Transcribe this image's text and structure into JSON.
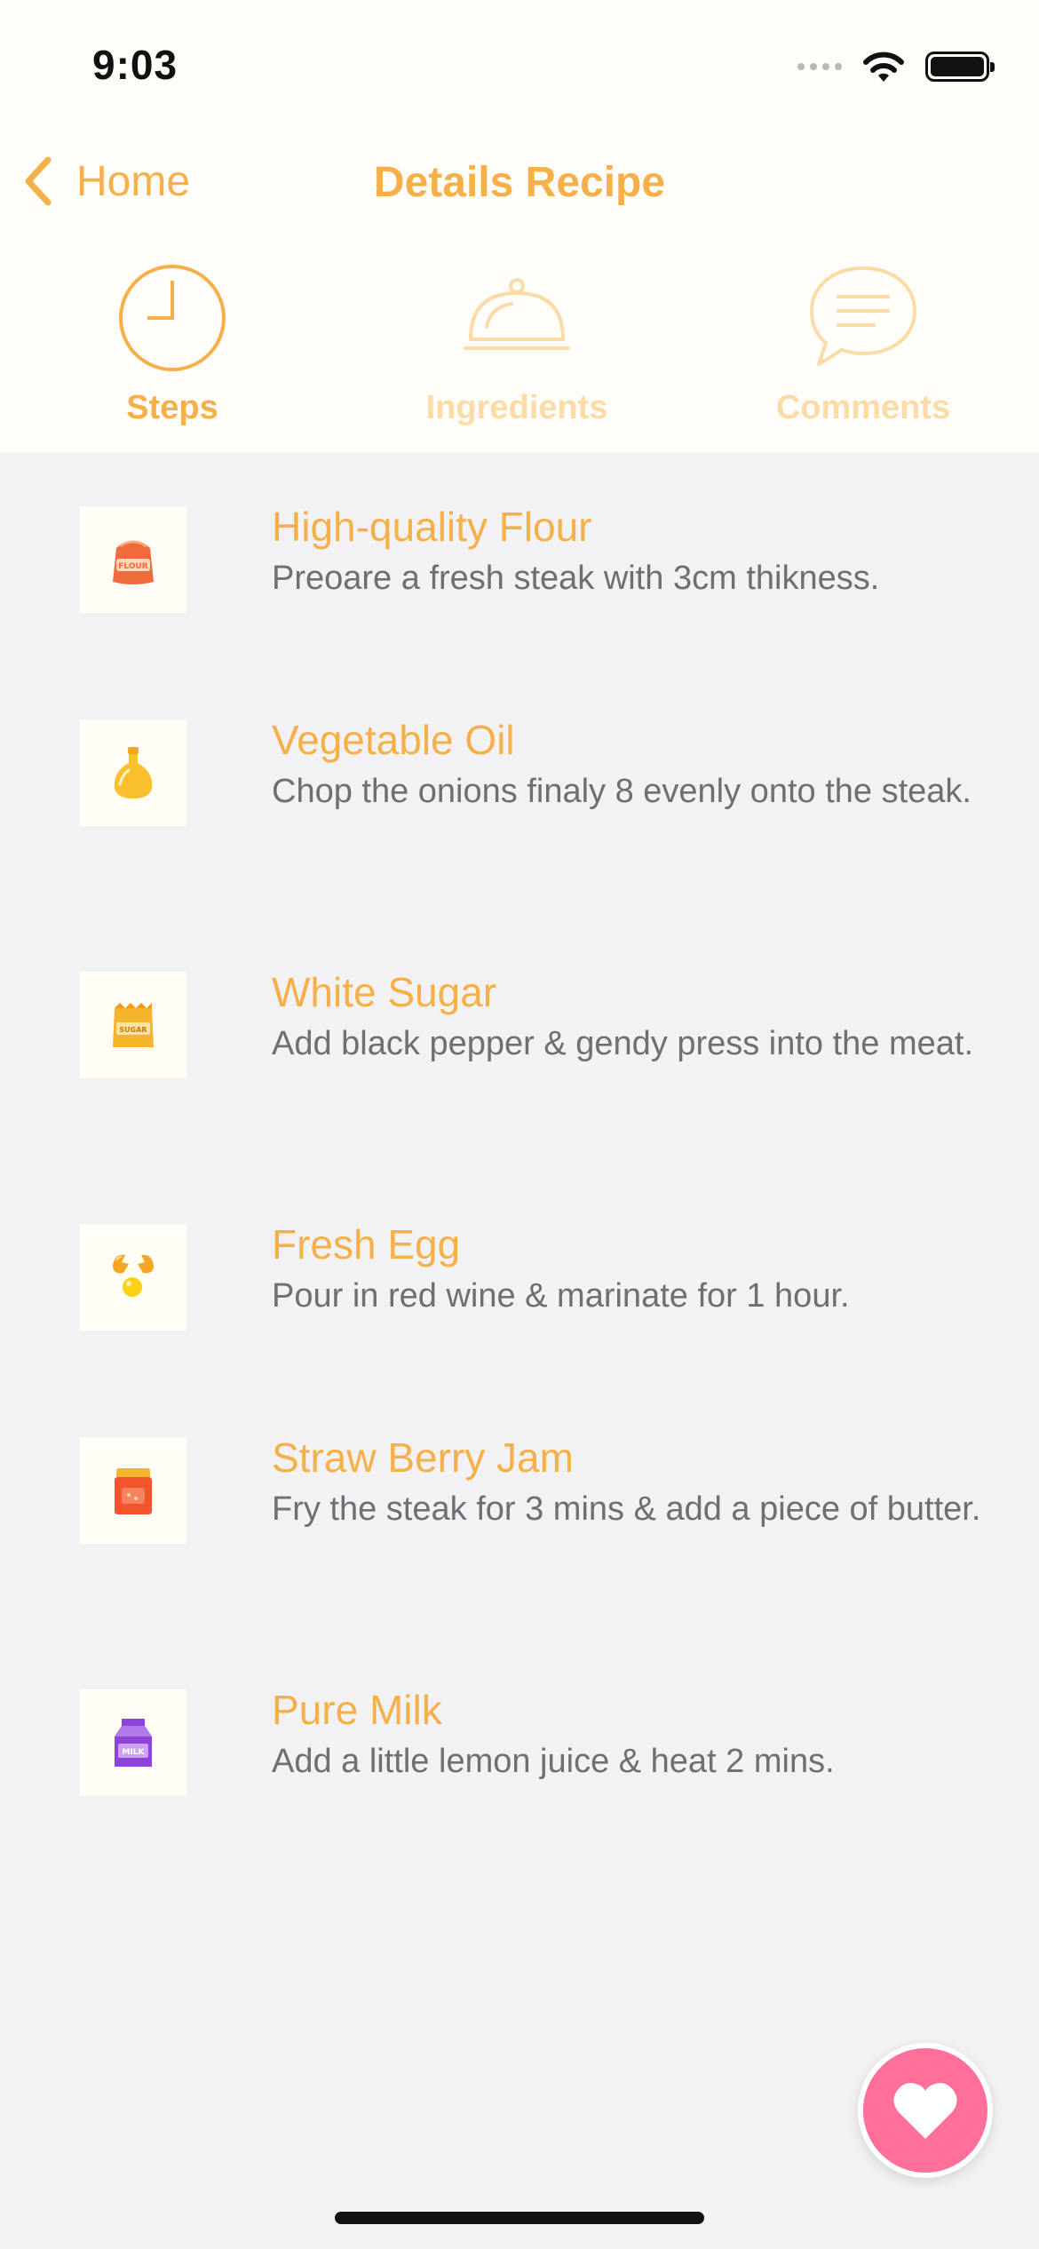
{
  "status_bar": {
    "time": "9:03"
  },
  "nav": {
    "back_label": "Home",
    "title": "Details Recipe"
  },
  "tabs": [
    {
      "label": "Steps",
      "icon": "clock-icon",
      "active": true
    },
    {
      "label": "Ingredients",
      "icon": "cloche-icon",
      "active": false
    },
    {
      "label": "Comments",
      "icon": "speech-bubble-icon",
      "active": false
    }
  ],
  "steps": [
    {
      "title": "High-quality Flour",
      "description": "Preoare a fresh steak with 3cm thikness.",
      "icon": "flour-bag-icon",
      "icon_text": "FLOUR"
    },
    {
      "title": "Vegetable Oil",
      "description": "Chop the onions finaly 8 evenly onto the steak.",
      "icon": "oil-bottle-icon"
    },
    {
      "title": "White Sugar",
      "description": "Add black pepper & gendy press into the meat.",
      "icon": "sugar-bag-icon",
      "icon_text": "SUGAR"
    },
    {
      "title": "Fresh Egg",
      "description": "Pour in red wine & marinate for 1 hour.",
      "icon": "cracked-egg-icon"
    },
    {
      "title": "Straw Berry Jam",
      "description": "Fry the steak for 3 mins & add a piece of butter.",
      "icon": "jam-jar-icon"
    },
    {
      "title": "Pure Milk",
      "description": "Add a little lemon juice & heat 2 mins.",
      "icon": "milk-carton-icon",
      "icon_text": "MILK"
    }
  ],
  "colors": {
    "accent": "#f5b049",
    "accent_muted": "#fbdca6",
    "favorite": "#ff6f9a",
    "body_text": "#6e6e73"
  },
  "favorite_button": {
    "icon": "heart-icon"
  }
}
